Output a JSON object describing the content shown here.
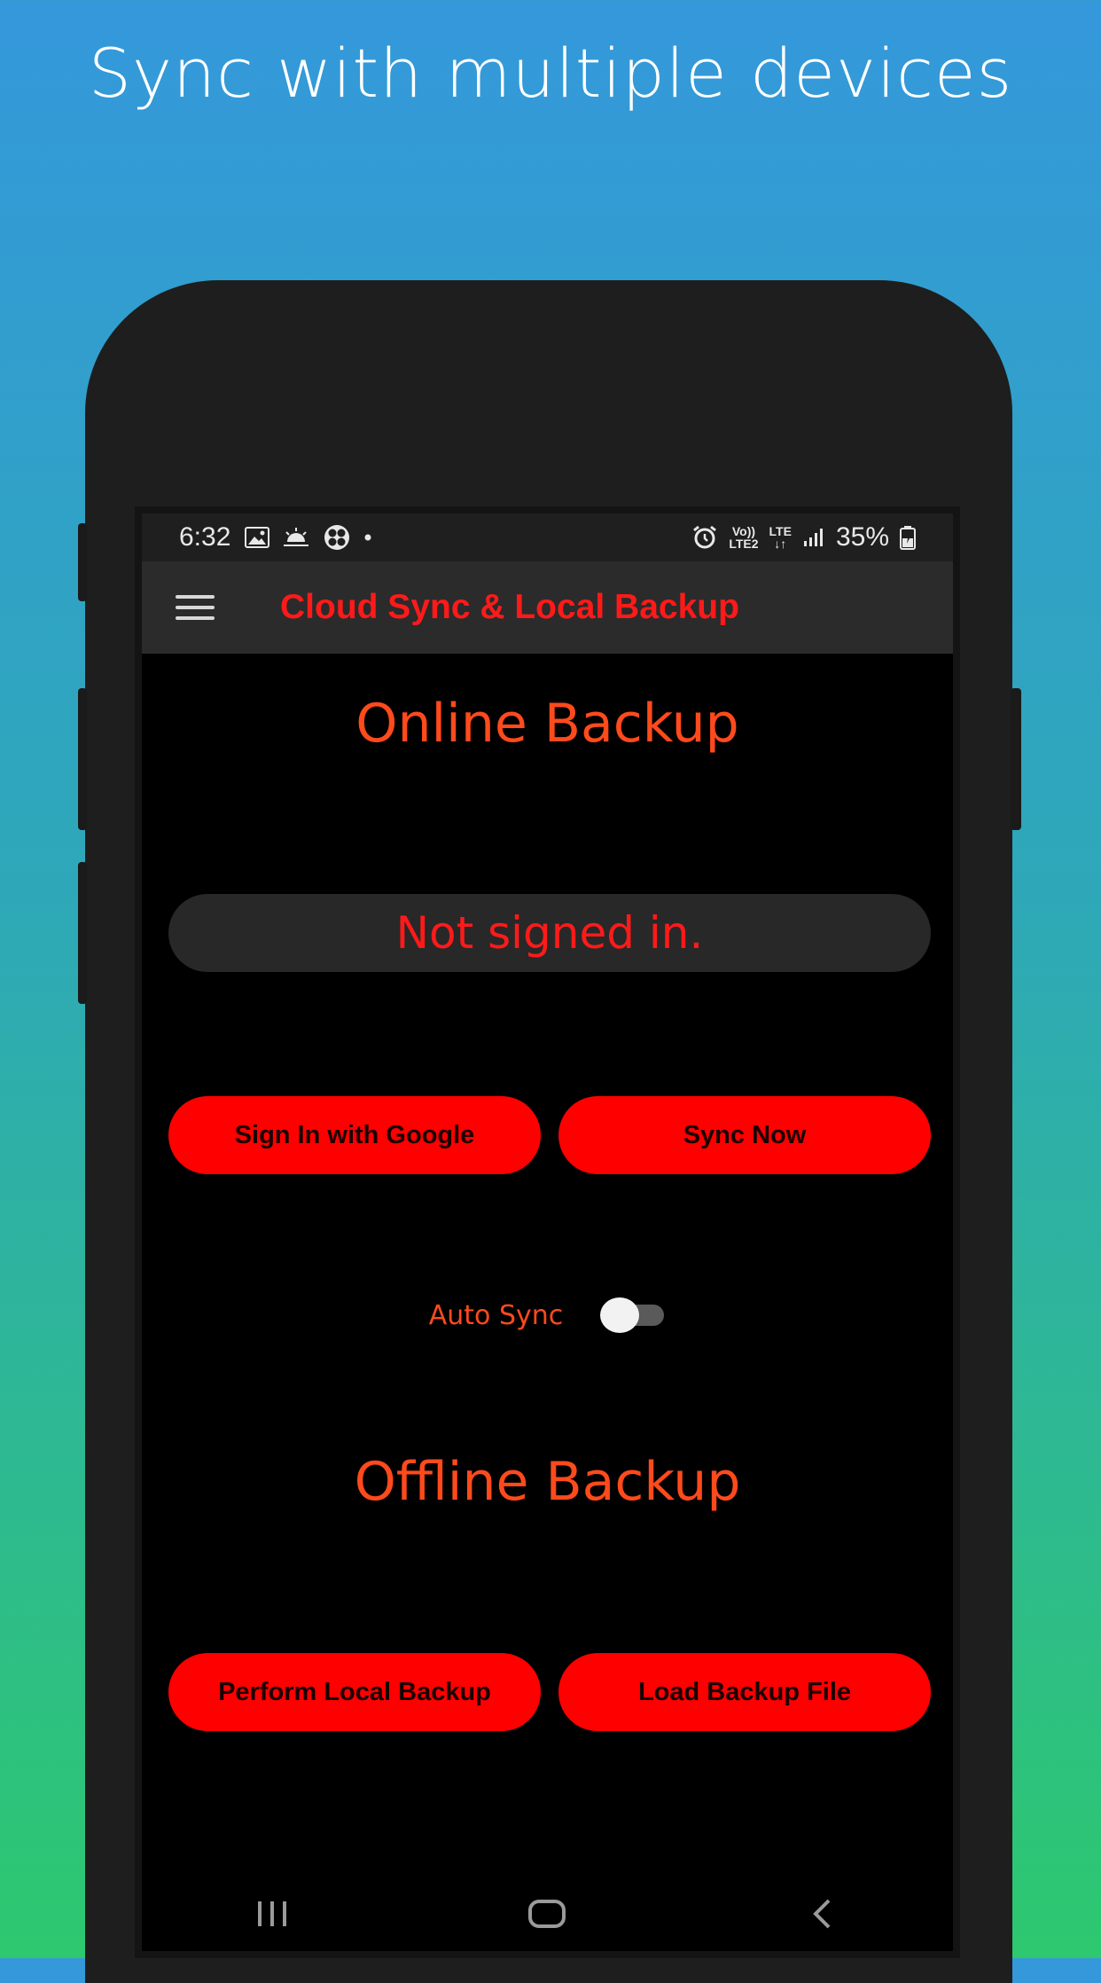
{
  "headline": "Sync with multiple devices",
  "status_bar": {
    "time": "6:32",
    "volte_label": "Vo))",
    "lte2_label": "LTE2",
    "lte_label": "LTE",
    "battery": "35%",
    "icons": [
      "image-icon",
      "weather-icon",
      "fan-icon",
      "dot-icon",
      "alarm-icon",
      "signal-icon",
      "battery-icon"
    ]
  },
  "toolbar": {
    "menu_icon": "hamburger-menu-icon",
    "title": "Cloud Sync & Local Backup"
  },
  "online": {
    "title": "Online Backup",
    "status": "Not signed in.",
    "sign_in_label": "Sign In with Google",
    "sync_now_label": "Sync Now",
    "auto_sync_label": "Auto Sync",
    "auto_sync_on": false
  },
  "offline": {
    "title": "Offline Backup",
    "local_backup_label": "Perform Local Backup",
    "load_backup_label": "Load Backup File"
  },
  "nav": {
    "icons": [
      "recents-icon",
      "home-icon",
      "back-icon"
    ]
  },
  "colors": {
    "accent_red": "#ff0000",
    "title_orange": "#ff4a1c",
    "toolbar_bg": "#2b2b2b",
    "screen_bg": "#000000"
  }
}
